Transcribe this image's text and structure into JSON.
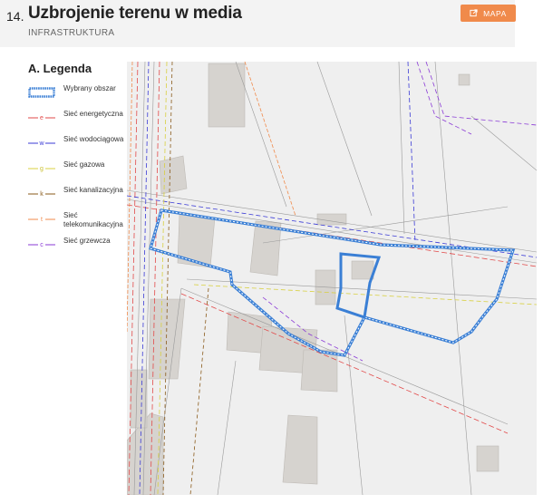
{
  "header": {
    "number": "14.",
    "title": "Uzbrojenie terenu w media",
    "subtitle": "INFRASTRUKTURA",
    "map_button_label": "MAPA",
    "map_button_icon": "external-link-icon",
    "accent_color": "#f08a4b"
  },
  "legend": {
    "title": "A. Legenda",
    "items": [
      {
        "label": "Wybrany obszar",
        "symbol": "selected-area-icon",
        "color": "#3a7fd5"
      },
      {
        "label": "Sieć energetyczna",
        "symbol": "power-line-icon",
        "letter": "e",
        "color": "#e24a4a"
      },
      {
        "label": "Sieć wodociągowa",
        "symbol": "water-line-icon",
        "letter": "w",
        "color": "#3b3bd6"
      },
      {
        "label": "Sieć gazowa",
        "symbol": "gas-line-icon",
        "letter": "g",
        "color": "#d8d040"
      },
      {
        "label": "Sieć kanalizacyjna",
        "symbol": "sewer-line-icon",
        "letter": "k",
        "color": "#8a5a1a"
      },
      {
        "label": "Sieć telekomunikacyjna",
        "symbol": "telecom-line-icon",
        "letter": "t",
        "color": "#f08a4b"
      },
      {
        "label": "Sieć grzewcza",
        "symbol": "heating-line-icon",
        "letter": "c",
        "color": "#8a3ad6"
      }
    ]
  }
}
